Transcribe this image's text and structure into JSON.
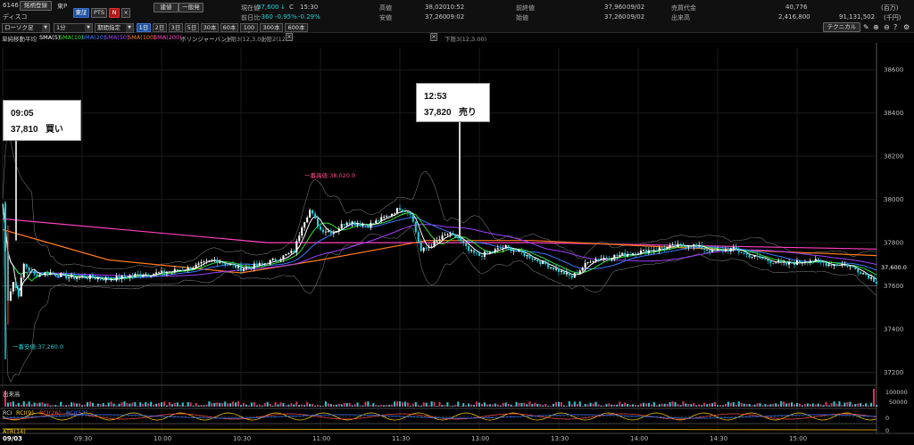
{
  "header": {
    "code": "6146",
    "name": "ディスコ",
    "brand_button": "銘柄登録",
    "market": "東P",
    "tse_button": "東証",
    "pts_button": "PTS",
    "n_button": "N",
    "close_icon_label": "×",
    "order_button": "建値",
    "settle_button": "一般発",
    "chart_type": "ローソク足",
    "interval": "1分",
    "period": "期間指定",
    "quotes": {
      "now_label": "現在値",
      "now_value": "37,600",
      "arrow": "↓",
      "c_flag": "C",
      "now_time": "15:30",
      "change_label": "前日比",
      "change_value": "-360",
      "change_pct": "-0.95%",
      "change_pct2": "-0.29%",
      "high_label": "高値",
      "high_value": "38,020",
      "high_time": "10:52",
      "low_label": "安値",
      "low_value": "37,260",
      "low_time": "09:02",
      "prev_label": "前終値",
      "prev_value": "37,960",
      "prev_date": "09/02",
      "open_label": "始値",
      "open_value": "37,260",
      "open_date": "09/02",
      "amount_label": "売買代金",
      "amount_value": "40,776",
      "amount_unit": "(百万)",
      "volume_label": "出来高",
      "volume_value": "2,416,800",
      "mktcap_value": "91,131,502",
      "mktcap_unit": "(千円)"
    },
    "tabs": [
      {
        "label": "1日",
        "active": true
      },
      {
        "label": "2日",
        "active": false
      },
      {
        "label": "3日",
        "active": false
      },
      {
        "label": "5日",
        "active": false
      },
      {
        "label": "30本",
        "active": false
      },
      {
        "label": "60本",
        "active": false
      },
      {
        "label": "100本",
        "active": false
      },
      {
        "label": "300本",
        "active": false
      },
      {
        "label": "600本",
        "active": false
      }
    ],
    "technical_button": "テクニカル"
  },
  "indicators": {
    "title": "単純移動平均",
    "sma5": "SMA(5)",
    "sma10": "SMA(10)",
    "sma20": "SMA(20)",
    "sma50": "SMA(50)",
    "sma100": "SMA(100)",
    "sma200": "SMA(200)",
    "bb": "ボリンジャーバンド",
    "bb1": "上限3(12,3.00)",
    "bb2": "上限2(12,",
    "bb3": "下限3(12,3.00)"
  },
  "colors": {
    "up": "#ffffff",
    "down": "#22cfd6",
    "sma5": "#ffffff",
    "sma10": "#33e033",
    "sma20": "#3a78ff",
    "sma50": "#a040ff",
    "sma100": "#ff7a1a",
    "sma200": "#ff40c0",
    "bb": "#707070",
    "accent": "#1c4f9c",
    "buy_marker": "#ffffff"
  },
  "annotations": {
    "buy": {
      "time": "09:05",
      "price": "37,810",
      "action": "買い"
    },
    "sell": {
      "time": "12:53",
      "price": "37,820",
      "action": "売り"
    },
    "high_note": "一番高値:38,020.0",
    "low_note": "一番安値:37,260.0",
    "last_price_label": "37,600.0"
  },
  "volume_panel": {
    "title": "出来高",
    "axis": [
      "100000",
      "50000"
    ]
  },
  "osc_panel": {
    "title": "RCI",
    "items": [
      "RCI(9)",
      "RCI(26)",
      "RCI(52)"
    ],
    "axis": [
      "0"
    ]
  },
  "atr_panel": {
    "title": "ATR(14)",
    "axis": [
      "0"
    ]
  },
  "chart_data": {
    "type": "candlestick",
    "title": "",
    "y_ticks": [
      38600,
      38400,
      38200,
      38000,
      37800,
      37600,
      37400,
      37200
    ],
    "ylim": [
      37140,
      38700
    ],
    "x_ticks": [
      {
        "label": "09/03",
        "minute": 0
      },
      {
        "label": "09:30",
        "minute": 30
      },
      {
        "label": "10:00",
        "minute": 60
      },
      {
        "label": "10:30",
        "minute": 90
      },
      {
        "label": "11:00",
        "minute": 120
      },
      {
        "label": "11:30",
        "minute": 150
      },
      {
        "label": "13:00",
        "minute": 180
      },
      {
        "label": "13:30",
        "minute": 210
      },
      {
        "label": "14:00",
        "minute": 240
      },
      {
        "label": "14:30",
        "minute": 270
      },
      {
        "label": "15:00",
        "minute": 300
      }
    ],
    "total_minutes": 330,
    "close_path": [
      [
        0,
        37980
      ],
      [
        2,
        37540
      ],
      [
        4,
        37620
      ],
      [
        6,
        37560
      ],
      [
        8,
        37700
      ],
      [
        12,
        37650
      ],
      [
        18,
        37660
      ],
      [
        25,
        37640
      ],
      [
        32,
        37640
      ],
      [
        40,
        37630
      ],
      [
        50,
        37650
      ],
      [
        60,
        37660
      ],
      [
        70,
        37680
      ],
      [
        80,
        37720
      ],
      [
        90,
        37680
      ],
      [
        98,
        37700
      ],
      [
        105,
        37730
      ],
      [
        110,
        37760
      ],
      [
        113,
        37880
      ],
      [
        116,
        37950
      ],
      [
        120,
        37860
      ],
      [
        125,
        37850
      ],
      [
        130,
        37900
      ],
      [
        138,
        37880
      ],
      [
        145,
        37920
      ],
      [
        150,
        37960
      ],
      [
        154,
        37940
      ],
      [
        158,
        37760
      ],
      [
        162,
        37790
      ],
      [
        168,
        37840
      ],
      [
        172,
        37820
      ],
      [
        176,
        37760
      ],
      [
        180,
        37740
      ],
      [
        190,
        37780
      ],
      [
        198,
        37740
      ],
      [
        205,
        37700
      ],
      [
        210,
        37670
      ],
      [
        215,
        37640
      ],
      [
        222,
        37720
      ],
      [
        232,
        37740
      ],
      [
        242,
        37760
      ],
      [
        252,
        37780
      ],
      [
        260,
        37790
      ],
      [
        268,
        37760
      ],
      [
        276,
        37770
      ],
      [
        282,
        37740
      ],
      [
        288,
        37720
      ],
      [
        296,
        37700
      ],
      [
        305,
        37720
      ],
      [
        312,
        37700
      ],
      [
        318,
        37700
      ],
      [
        325,
        37660
      ],
      [
        330,
        37620
      ]
    ],
    "sma200_path": [
      [
        0,
        37910
      ],
      [
        100,
        37800
      ],
      [
        200,
        37800
      ],
      [
        330,
        37770
      ]
    ],
    "sma100_path": [
      [
        0,
        37860
      ],
      [
        40,
        37720
      ],
      [
        90,
        37660
      ],
      [
        120,
        37720
      ],
      [
        160,
        37810
      ],
      [
        200,
        37810
      ],
      [
        250,
        37780
      ],
      [
        330,
        37740
      ]
    ]
  }
}
